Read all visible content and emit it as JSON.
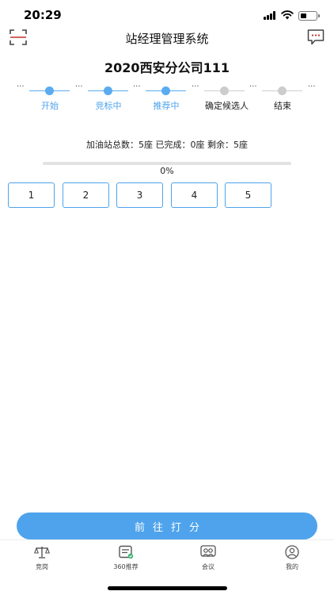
{
  "status_bar": {
    "time": "20:29"
  },
  "nav": {
    "title": "站经理管理系统"
  },
  "company": {
    "name": "2020西安分公司111"
  },
  "steps": [
    {
      "label": "开始",
      "active": true
    },
    {
      "label": "竞标中",
      "active": true
    },
    {
      "label": "推荐中",
      "active": true
    },
    {
      "label": "确定候选人",
      "active": false
    },
    {
      "label": "结束",
      "active": false
    }
  ],
  "steps_ellipsis": "···",
  "summary": {
    "text": "加油站总数：5座 已完成：0座 剩余：5座"
  },
  "progress": {
    "value": 0,
    "label": "0%"
  },
  "stations": [
    "1",
    "2",
    "3",
    "4",
    "5"
  ],
  "actions": {
    "go_label": "前往打分"
  },
  "tabs": [
    {
      "label": "竞岗",
      "icon": "scale-icon"
    },
    {
      "label": "360推荐",
      "icon": "recommend-icon"
    },
    {
      "label": "会议",
      "icon": "meeting-icon"
    },
    {
      "label": "我的",
      "icon": "profile-icon"
    }
  ],
  "colors": {
    "accent": "#4ea3ec",
    "inactive": "#cccccc",
    "badge": "#c0302a"
  }
}
